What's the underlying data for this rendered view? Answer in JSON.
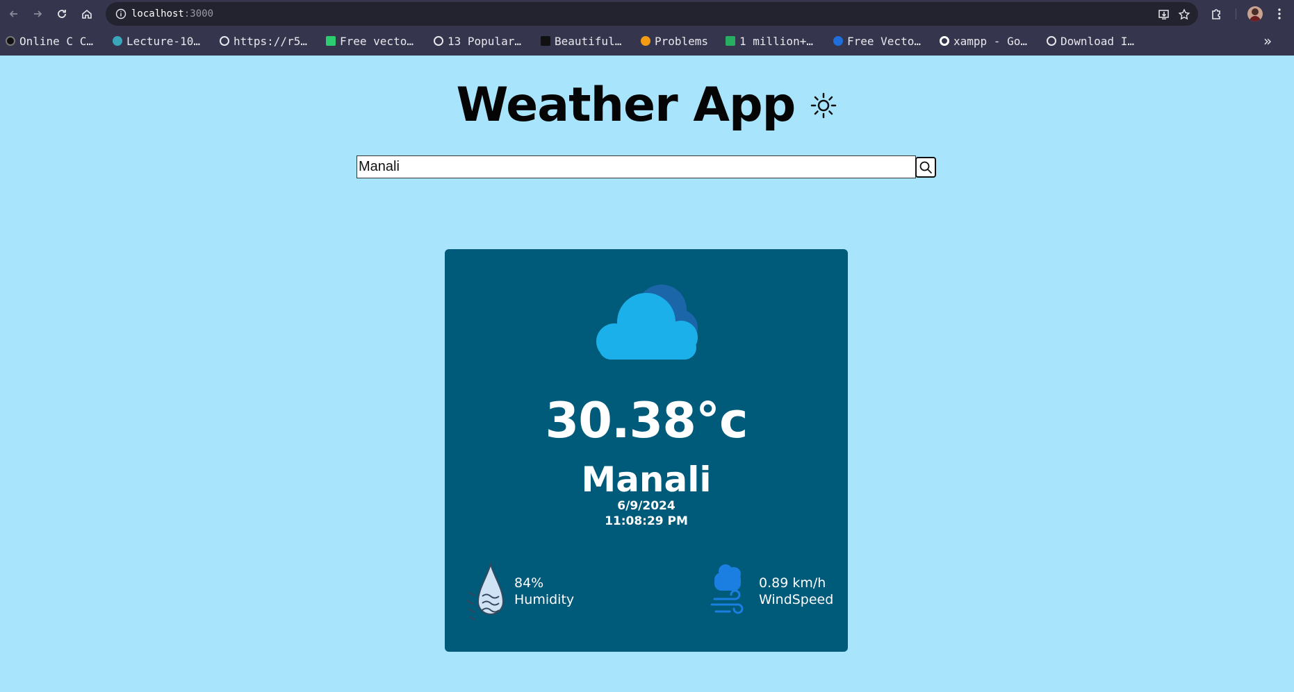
{
  "browser": {
    "url_host": "localhost",
    "url_port": ":3000",
    "bookmarks": [
      {
        "label": "Online C C…",
        "icon": "eye-icon",
        "color": "#222222"
      },
      {
        "label": "Lecture-10…",
        "icon": "s-logo-icon",
        "color": "#3aa6b9"
      },
      {
        "label": "https://r5…",
        "icon": "globe-icon",
        "color": "#e8e8ee"
      },
      {
        "label": "Free vecto…",
        "icon": "vector-logo-icon",
        "color": "#2ecc71"
      },
      {
        "label": "13 Popular…",
        "icon": "globe-icon",
        "color": "#e8e8ee"
      },
      {
        "label": "Beautiful…",
        "icon": "tools-icon",
        "color": "#111111"
      },
      {
        "label": "Problems",
        "icon": "code-logo-icon",
        "color": "#f39c12"
      },
      {
        "label": "1 million+…",
        "icon": "px-logo-icon",
        "color": "#27ae60"
      },
      {
        "label": "Free Vecto…",
        "icon": "shield-logo-icon",
        "color": "#1e6fd9"
      },
      {
        "label": "xampp - Go…",
        "icon": "google-icon",
        "color": "#ffffff"
      },
      {
        "label": "Download I…",
        "icon": "globe-icon",
        "color": "#e8e8ee"
      }
    ]
  },
  "app": {
    "title": "Weather App",
    "title_icon": "sun-icon"
  },
  "search": {
    "value": "Manali",
    "button_icon": "search-icon"
  },
  "weather": {
    "condition_icon": "cloud-icon",
    "temperature": "30.38°c",
    "city": "Manali",
    "date": "6/9/2024",
    "time": "11:08:29 PM",
    "humidity_value": "84%",
    "humidity_label": "Humidity",
    "wind_value": "0.89 km/h",
    "wind_label": "WindSpeed"
  },
  "colors": {
    "page_background": "#a8e4fb",
    "card_background": "#005a79",
    "cloud_front": "#1bb0ea",
    "cloud_back": "#1a66a8"
  }
}
